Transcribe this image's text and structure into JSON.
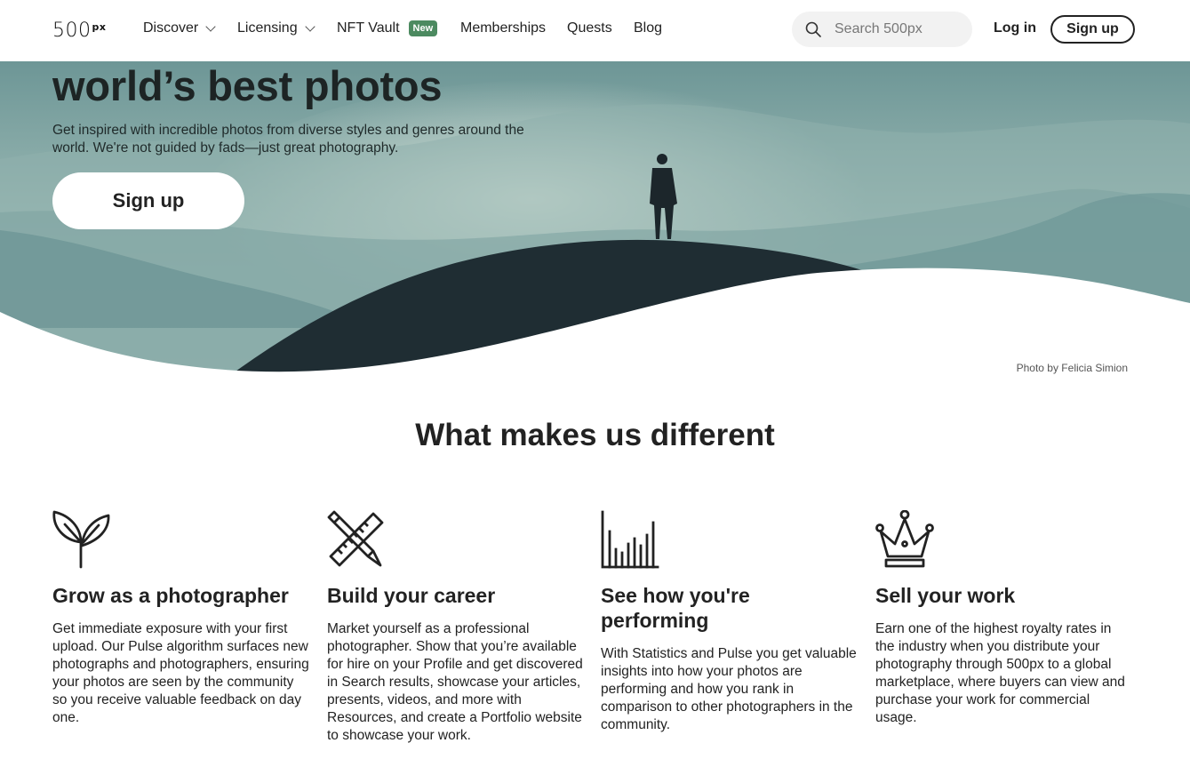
{
  "nav": {
    "logo": "500",
    "logo_sup": "px",
    "items": [
      {
        "label": "Discover",
        "dropdown": true
      },
      {
        "label": "Licensing",
        "dropdown": true
      },
      {
        "label": "NFT Vault",
        "badge": "New"
      },
      {
        "label": "Memberships"
      },
      {
        "label": "Quests"
      },
      {
        "label": "Blog"
      }
    ],
    "search_placeholder": "Search 500px",
    "login": "Log in",
    "signup": "Sign up"
  },
  "hero": {
    "title": "world’s best photos",
    "subtitle": "Get inspired with incredible photos from diverse styles and genres around the world. We're not guided by fads—just great photography.",
    "cta": "Sign up",
    "credit": "Photo by Felicia Simion"
  },
  "section": {
    "title": "What makes us different",
    "features": [
      {
        "icon": "sprout-icon",
        "title": "Grow as a photographer",
        "text": "Get immediate exposure with your first upload. Our Pulse algorithm surfaces new photographs and photographers, ensuring your photos are seen by the community so you receive valuable feedback on day one."
      },
      {
        "icon": "pencil-ruler-icon",
        "title": "Build your career",
        "text": "Market yourself as a professional photographer. Show that you’re available for hire on your Profile and get discovered in Search results, showcase your articles, presents, videos, and more with Resources, and create a Portfolio website to showcase your work."
      },
      {
        "icon": "bar-chart-icon",
        "title": "See how you're performing",
        "text": "With Statistics and Pulse you get valuable insights into how your photos are performing and how you rank in comparison to other photographers in the community."
      },
      {
        "icon": "crown-icon",
        "title": "Sell your work",
        "text": "Earn one of the highest royalty rates in the industry when you distribute your photography through 500px to a global marketplace, where buyers can view and purchase your work for commercial usage."
      }
    ]
  },
  "colors": {
    "badge": "#4c8a60",
    "sky": "#7fa6a6",
    "hill": "#1e2c33"
  }
}
